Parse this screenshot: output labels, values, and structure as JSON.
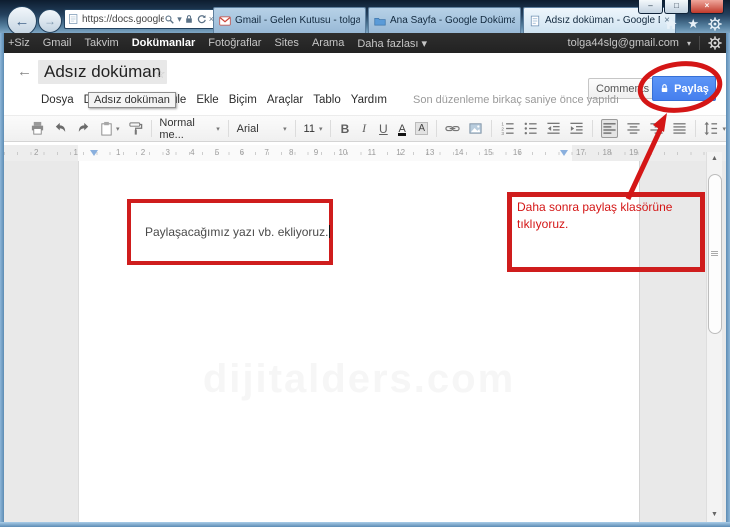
{
  "browser": {
    "url": "https://docs.google.com/do",
    "tabs": [
      {
        "title": "Gmail - Gelen Kutusu - tolga44..."
      },
      {
        "title": "Ana Sayfa - Google Dokümanl..."
      },
      {
        "title": "Adsız doküman - Google D..."
      }
    ]
  },
  "google_bar": {
    "items": [
      "+Siz",
      "Gmail",
      "Takvim",
      "Dokümanlar",
      "Fotoğraflar",
      "Sites",
      "Arama",
      "Daha fazlası ▾"
    ],
    "account_email": "tolga44slg@gmail.com"
  },
  "header": {
    "title": "Adsız doküman",
    "title_tooltip": "Adsız doküman",
    "comments_label": "Comments",
    "share_label": "Paylaş",
    "menus": [
      "Dosya",
      "Düzenle",
      "Görüntüle",
      "Ekle",
      "Biçim",
      "Araçlar",
      "Tablo",
      "Yardım"
    ],
    "last_edit": "Son düzenleme birkaç saniye önce yapıldı"
  },
  "toolbar": {
    "style": "Normal me...",
    "font": "Arial",
    "size": "11",
    "bold": "B",
    "italic": "I",
    "underline": "U",
    "text_color": "A",
    "highlight": "A"
  },
  "ruler": {
    "left_numbers": [
      "2",
      "1"
    ],
    "main_numbers": [
      "1",
      "2",
      "3",
      "4",
      "5",
      "6",
      "7",
      "8",
      "9",
      "10",
      "11",
      "12",
      "13",
      "14",
      "15",
      "16"
    ],
    "right_numbers": [
      "17",
      "18",
      "19"
    ]
  },
  "page": {
    "text": "Paylaşacağımız yazı vb. ekliyoruz.",
    "watermark": "dijitalders.com"
  },
  "annotations": {
    "note_text": "Daha sonra paylaş klasörüne tıklıyoruz.",
    "red_color": "#cf1d1d"
  },
  "icons": {
    "close": "×",
    "minimize": "–",
    "maximize": "□",
    "caret_down": "▾",
    "star_outline": "☆",
    "star_filled": "★",
    "back_arrow": "←",
    "forward_arrow": "→",
    "scroll_up": "▲",
    "scroll_down": "▼"
  }
}
